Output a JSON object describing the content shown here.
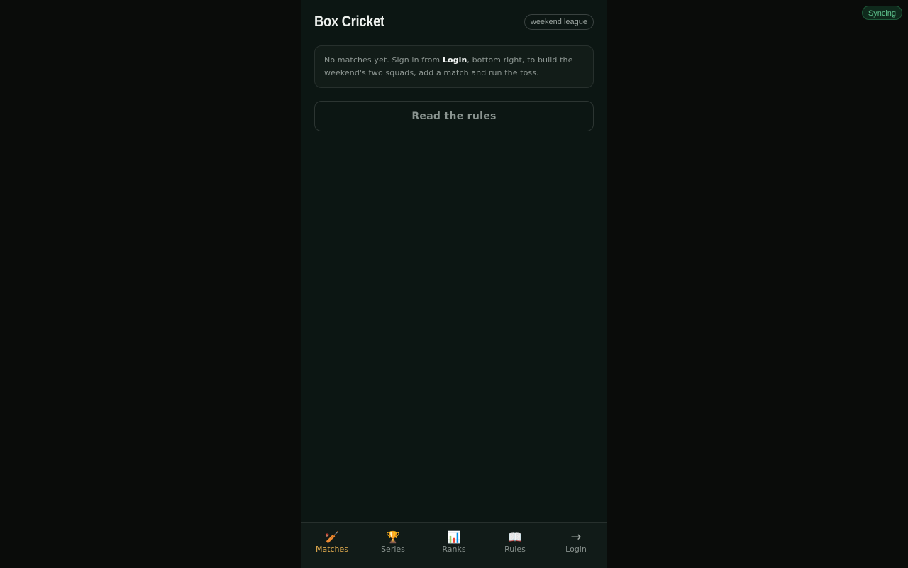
{
  "status": {
    "sync_label": "Syncing",
    "sync_color": "#5fc48e"
  },
  "header": {
    "title": "Box Cricket",
    "league_tag": "weekend league"
  },
  "notice": {
    "text_before": "No matches yet. Sign in from ",
    "link_word": "Login",
    "text_after": ", bottom right, to build the weekend's two squads, add a match and run the toss."
  },
  "rules_button": {
    "label": "Read the rules"
  },
  "nav": {
    "active_color": "#e2ad4f",
    "items": [
      {
        "icon": "🏏",
        "icon_name": "cricket-bat-icon",
        "label": "Matches",
        "active": true
      },
      {
        "icon": "🏆",
        "icon_name": "trophy-icon",
        "label": "Series",
        "active": false
      },
      {
        "icon": "📊",
        "icon_name": "bar-chart-icon",
        "label": "Ranks",
        "active": false
      },
      {
        "icon": "📖",
        "icon_name": "open-book-icon",
        "label": "Rules",
        "active": false
      },
      {
        "icon": "→",
        "icon_name": "arrow-right-icon",
        "label": "Login",
        "active": false
      }
    ]
  }
}
